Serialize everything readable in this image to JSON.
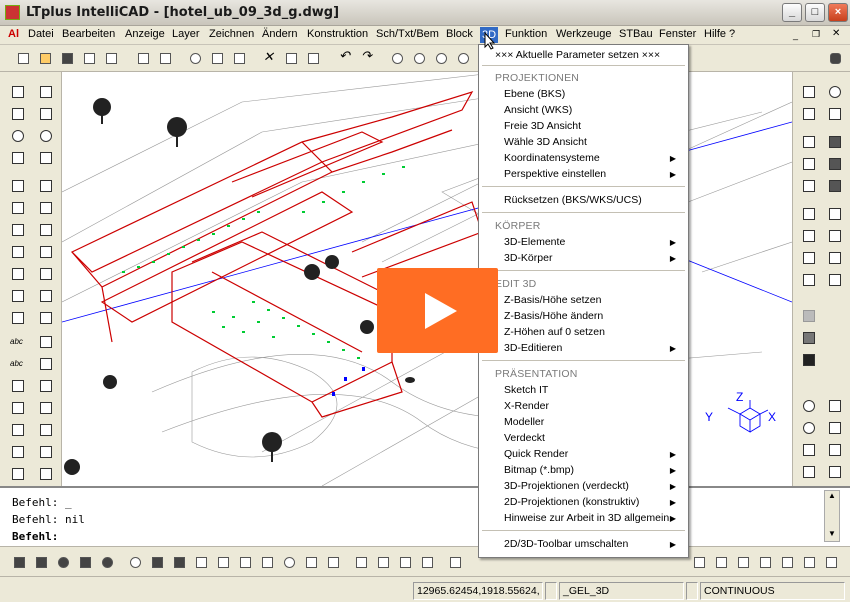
{
  "window": {
    "title": "LTplus IntelliCAD - [hotel_ub_09_3d_g.dwg]",
    "minimize": "_",
    "maximize": "□",
    "close": "×"
  },
  "menubar": {
    "logo": "Al",
    "items": [
      "Datei",
      "Bearbeiten",
      "Anzeige",
      "Layer",
      "Zeichnen",
      "Ändern",
      "Konstruktion",
      "Sch/Txt/Bem",
      "Block",
      "3D",
      "Funktion",
      "Werkzeuge",
      "STBau",
      "Fenster",
      "Hilfe ?"
    ]
  },
  "dropdown": {
    "current": "××× Aktuelle Parameter setzen ×××",
    "h1": "PROJEKTIONEN",
    "g1": [
      "Ebene  (BKS)",
      "Ansicht (WKS)",
      "Freie 3D Ansicht",
      "Wähle 3D Ansicht",
      "Koordinatensysteme",
      "Perspektive einstellen"
    ],
    "reset": "Rücksetzen (BKS/WKS/UCS)",
    "h2": "KÖRPER",
    "g2": [
      "3D-Elemente",
      "3D-Körper"
    ],
    "h3": "EDIT 3D",
    "g3": [
      "Z-Basis/Höhe setzen",
      "Z-Basis/Höhe ändern",
      "Z-Höhen auf 0 setzen",
      "3D-Editieren"
    ],
    "h4": "PRÄSENTATION",
    "g4": [
      "Sketch IT",
      "X-Render",
      "Modeller",
      "Verdeckt",
      "Quick Render",
      "Bitmap (*.bmp)",
      "3D-Projektionen (verdeckt)",
      "2D-Projektionen (konstruktiv)",
      "Hinweise zur Arbeit in 3D allgemein"
    ],
    "toggle": "2D/3D-Toolbar umschalten"
  },
  "command": {
    "line1": "Befehl: _",
    "line2": "Befehl: nil",
    "prompt": "Befehl:"
  },
  "axis": {
    "y": "Y",
    "z": "Z",
    "x": "X"
  },
  "status": {
    "coords": "12965.62454,1918.55624,",
    "layer": "_GEL_3D",
    "linetype": "CONTINUOUS"
  },
  "colors": {
    "accent": "#316ac5",
    "play": "#ff6d23",
    "building": "#cc0000",
    "window_green": "#00cc33",
    "axis_blue": "#0000ff"
  }
}
